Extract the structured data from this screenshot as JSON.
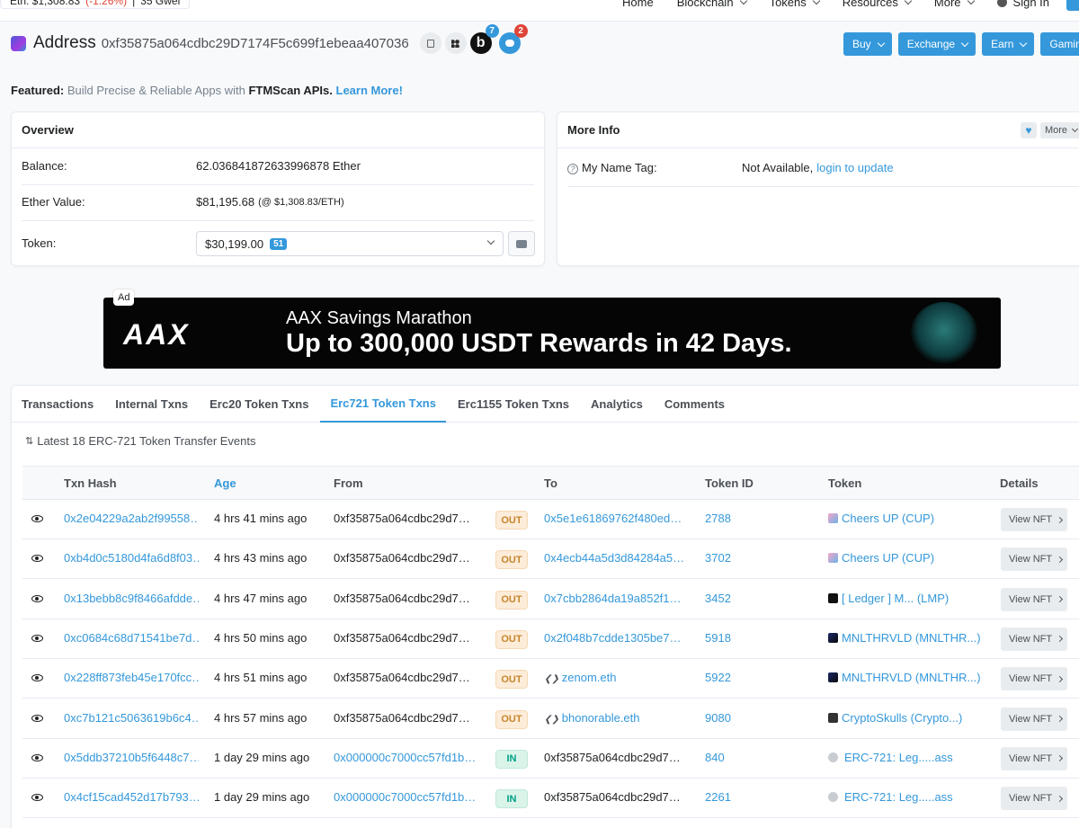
{
  "topbar": {
    "price_label": "Eth: $1,308.83",
    "price_change": "(-1.26%)",
    "gas": "35 Gwei",
    "nav": [
      "Home",
      "Blockchain",
      "Tokens",
      "Resources",
      "More"
    ],
    "sign_in": "Sign In"
  },
  "header": {
    "title": "Address",
    "address": "0xf35875a064cdbc29D7174F5c699f1ebeaa407036",
    "b_label": "b",
    "b_badge": "7",
    "chat_badge": "2",
    "buttons": [
      "Buy",
      "Exchange",
      "Earn",
      "Gaming"
    ]
  },
  "featured": {
    "prefix": "Featured:",
    "text": " Build Precise & Reliable Apps with ",
    "brand": "FTMScan APIs.",
    "link": " Learn More!"
  },
  "overview": {
    "title": "Overview",
    "balance_label": "Balance:",
    "balance_value": "62.036841872633996878 Ether",
    "ether_value_label": "Ether Value:",
    "ether_value": "$81,195.68",
    "ether_rate": "(@ $1,308.83/ETH)",
    "token_label": "Token:",
    "token_value": "$30,199.00",
    "token_count": "51"
  },
  "more_info": {
    "title": "More Info",
    "more_button": "More",
    "name_tag_label": "My Name Tag:",
    "name_tag_value": "Not Available,",
    "name_tag_link": "login to update"
  },
  "ad": {
    "badge": "Ad",
    "logo": "AAX",
    "line1": "AAX Savings Marathon",
    "line2": "Up to 300,000 USDT Rewards in 42 Days."
  },
  "tabs": [
    "Transactions",
    "Internal Txns",
    "Erc20 Token Txns",
    "Erc721 Token Txns",
    "Erc1155 Token Txns",
    "Analytics",
    "Comments"
  ],
  "active_tab": "Erc721 Token Txns",
  "table": {
    "summary": "Latest 18 ERC-721 Token Transfer Events",
    "headers": [
      "Txn Hash",
      "Age",
      "From",
      "To",
      "Token ID",
      "Token",
      "Details"
    ],
    "rows": [
      {
        "hash": "0x2e04229a2ab2f99558…",
        "age": "4 hrs 41 mins ago",
        "from": "0xf35875a064cdbc29d7…",
        "dir": "OUT",
        "to": "0x5e1e61869762f480ed…",
        "token_id": "2788",
        "token": "Cheers UP (CUP)",
        "details": "View NFT"
      },
      {
        "hash": "0xb4d0c5180d4fa6d8f03…",
        "age": "4 hrs 43 mins ago",
        "from": "0xf35875a064cdbc29d7…",
        "dir": "OUT",
        "to": "0x4ecb44a5d3d84284a5…",
        "token_id": "3702",
        "token": "Cheers UP (CUP)",
        "details": "View NFT"
      },
      {
        "hash": "0x13bebb8c9f8466afdde…",
        "age": "4 hrs 47 mins ago",
        "from": "0xf35875a064cdbc29d7…",
        "dir": "OUT",
        "to": "0x7cbb2864da19a852f1…",
        "token_id": "3452",
        "token": "[ Ledger ] M... (LMP)",
        "details": "View NFT"
      },
      {
        "hash": "0xc0684c68d71541be7d…",
        "age": "4 hrs 50 mins ago",
        "from": "0xf35875a064cdbc29d7…",
        "dir": "OUT",
        "to": "0x2f048b7cdde1305be7…",
        "token_id": "5918",
        "token": "MNLTHRVLD (MNLTHR...)",
        "details": "View NFT"
      },
      {
        "hash": "0x228ff873feb45e170fcc…",
        "age": "4 hrs 51 mins ago",
        "from": "0xf35875a064cdbc29d7…",
        "dir": "OUT",
        "to": "zenom.eth",
        "token_id": "5922",
        "token": "MNLTHRVLD (MNLTHR...)",
        "details": "View NFT"
      },
      {
        "hash": "0xc7b121c5063619b6c4…",
        "age": "4 hrs 57 mins ago",
        "from": "0xf35875a064cdbc29d7…",
        "dir": "OUT",
        "to": "bhonorable.eth",
        "token_id": "9080",
        "token": "CryptoSkulls (Crypto...)",
        "details": "View NFT"
      },
      {
        "hash": "0x5ddb37210b5f6448c7…",
        "age": "1 day 29 mins ago",
        "from": "0x000000c7000cc57fd1b…",
        "dir": "IN",
        "to": "0xf35875a064cdbc29d7…",
        "token_id": "840",
        "token": "ERC-721: Leg.....ass",
        "details": "View NFT"
      },
      {
        "hash": "0x4cf15cad452d17b793…",
        "age": "1 day 29 mins ago",
        "from": "0x000000c7000cc57fd1b…",
        "dir": "IN",
        "to": "0xf35875a064cdbc29d7…",
        "token_id": "2261",
        "token": "ERC-721: Leg.....ass",
        "details": "View NFT"
      }
    ]
  },
  "colors": {
    "accent": "#3498db",
    "out_badge": "#c6862b",
    "in_badge": "#00a186",
    "negative": "#de4437"
  }
}
